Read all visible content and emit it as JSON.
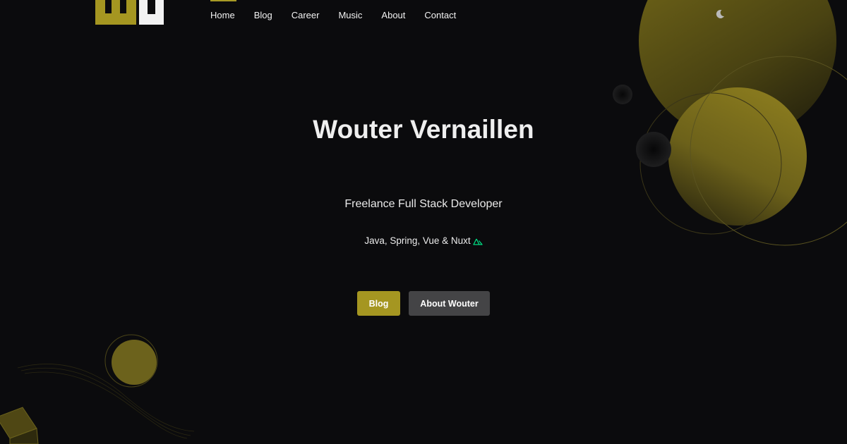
{
  "brand": {
    "logo_icon": "wv-logo-icon",
    "accent": "#a59621"
  },
  "nav": {
    "items": [
      {
        "label": "Home",
        "active": true
      },
      {
        "label": "Blog",
        "active": false
      },
      {
        "label": "Career",
        "active": false
      },
      {
        "label": "Music",
        "active": false
      },
      {
        "label": "About",
        "active": false
      },
      {
        "label": "Contact",
        "active": false
      }
    ],
    "theme_toggle_icon": "moon-icon"
  },
  "hero": {
    "title": "Wouter Vernaillen",
    "subtitle": "Freelance Full Stack Developer",
    "stack": "Java, Spring, Vue & Nuxt",
    "stack_icon": "nuxt-icon"
  },
  "buttons": {
    "primary_label": "Blog",
    "secondary_label": "About Wouter"
  },
  "colors": {
    "background": "#0b0b0d",
    "primary_button": "#a59621",
    "secondary_button": "#444446",
    "nuxt_green": "#00dc82"
  }
}
